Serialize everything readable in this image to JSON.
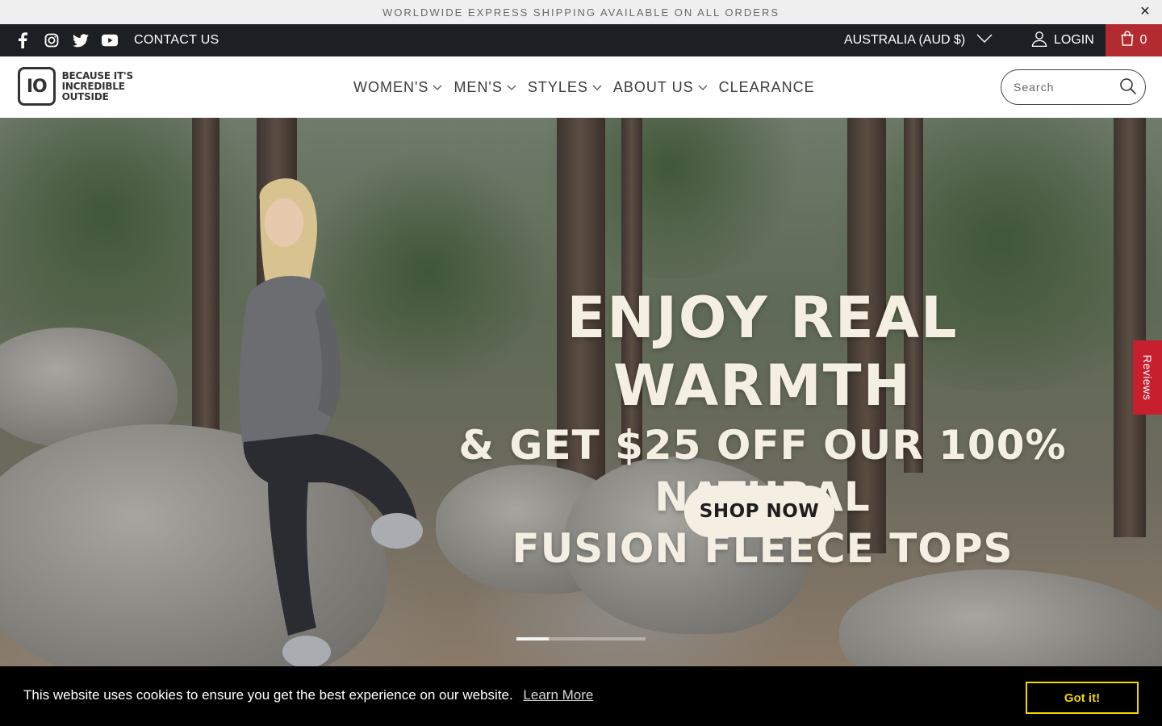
{
  "announcement": {
    "text": "WORLDWIDE EXPRESS SHIPPING AVAILABLE ON ALL ORDERS",
    "close_icon": "close-icon"
  },
  "topbar": {
    "social_icons": [
      "facebook-icon",
      "instagram-icon",
      "twitter-icon",
      "youtube-icon"
    ],
    "contact_label": "CONTACT US",
    "currency_label": "AUSTRALIA (AUD $)",
    "login_label": "LOGIN",
    "cart_count": "0",
    "cart_color": "#b32b2e"
  },
  "header": {
    "logo_mark": "IO",
    "logo_line1": "BECAUSE IT'S",
    "logo_line2": "INCREDIBLE OUTSIDE",
    "nav": [
      {
        "label": "WOMEN'S",
        "dropdown": true
      },
      {
        "label": "MEN'S",
        "dropdown": true
      },
      {
        "label": "STYLES",
        "dropdown": true
      },
      {
        "label": "ABOUT US",
        "dropdown": true
      },
      {
        "label": "CLEARANCE",
        "dropdown": false
      }
    ],
    "search_placeholder": "Search"
  },
  "hero": {
    "headline_line1": "ENJOY REAL WARMTH",
    "headline_line2": "& GET $25 OFF OUR 100% NATURAL",
    "headline_line3": "FUSION FLEECE TOPS",
    "cta_label": "SHOP NOW",
    "slides_total": 4,
    "slide_active": 1,
    "reviews_tab_label": "Reviews",
    "reviews_tab_color": "#c71f2e"
  },
  "cookie": {
    "message": "This website uses cookies to ensure you get the best experience on our website.",
    "link_label": "Learn More",
    "button_label": "Got it!",
    "accent_color": "#f1d600"
  }
}
